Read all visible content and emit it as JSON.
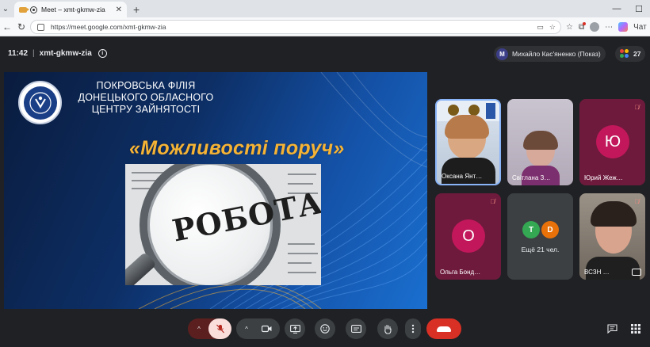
{
  "browser": {
    "tab_title": "Meet – xmt-gkmw-zia",
    "url": "https://meet.google.com/xmt-gkmw-zia",
    "chat_label": "Чат"
  },
  "meet": {
    "time": "11:42",
    "separator": "|",
    "meeting_code": "xmt-gkmw-zia",
    "presenter_initial": "М",
    "presenter_label": "Михайло Кас'яненко (Показ)",
    "participant_count": "27"
  },
  "slide": {
    "org_line1": "ПОКРОВСЬКА ФІЛІЯ",
    "org_line2": "ДОНЕЦЬКОГО ОБЛАСНОГО",
    "org_line3": "ЦЕНТРУ ЗАЙНЯТОСТІ",
    "title": "«Можливості поруч»",
    "photo_text": "РОБОТА!"
  },
  "participants": [
    {
      "name": "Оксана Янт…",
      "speaking": true
    },
    {
      "name": "Світлана З…"
    },
    {
      "name": "Юрий Жеж…",
      "initial": "Ю",
      "muted": true
    },
    {
      "name": "Ольга Бонд…",
      "initial": "О",
      "muted": true
    },
    {
      "more_label": "Ещё 21 чел.",
      "initials": [
        "T",
        "D"
      ]
    },
    {
      "name": "ВСЗН …",
      "muted": true
    }
  ],
  "colors": {
    "meet_bg": "#202124",
    "avatar_pink": "#c2185b",
    "end_call": "#d93025",
    "title_gold": "#f5b335"
  },
  "icons": {
    "more_people": "more-people-icon",
    "raise_hand": "raise-hand-icon"
  }
}
